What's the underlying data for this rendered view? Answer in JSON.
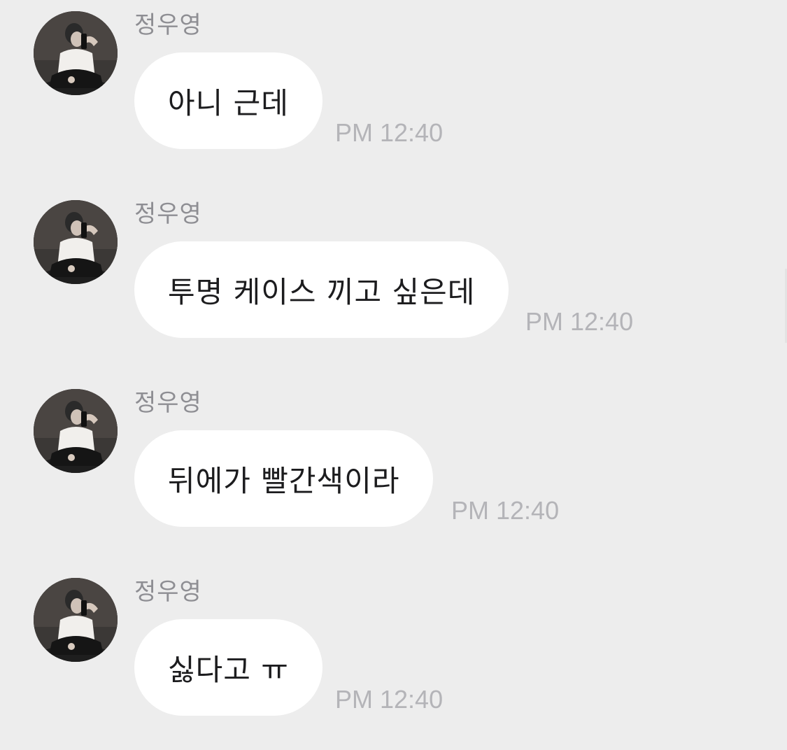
{
  "chat": {
    "messages": [
      {
        "sender": "정우영",
        "text": "아니 근데",
        "time": "PM 12:40"
      },
      {
        "sender": "정우영",
        "text": "투명 케이스 끼고 싶은데",
        "time": "PM 12:40"
      },
      {
        "sender": "정우영",
        "text": "뒤에가 빨간색이라",
        "time": "PM 12:40"
      },
      {
        "sender": "정우영",
        "text": "싫다고 ㅠ",
        "time": "PM 12:40"
      }
    ]
  },
  "colors": {
    "background": "#ededed",
    "bubble": "#ffffff",
    "sender_text": "#8e8e93",
    "time_text": "#b4b4b8"
  },
  "icons": {
    "avatar": "profile-photo"
  }
}
